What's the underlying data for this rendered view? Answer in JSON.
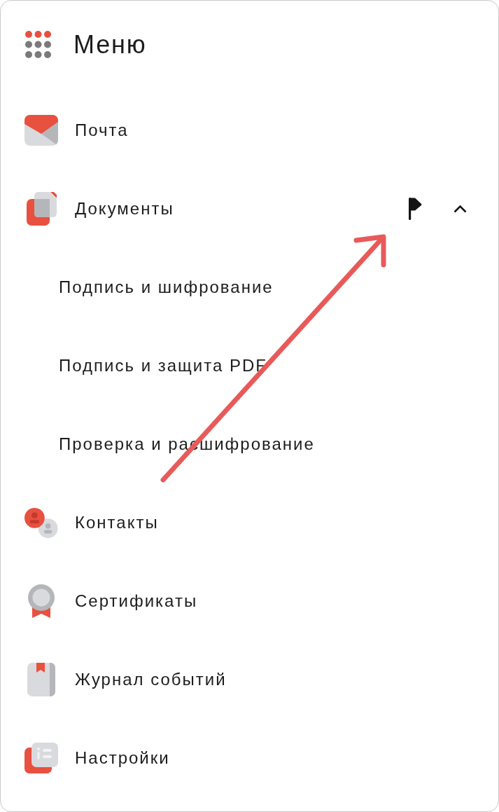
{
  "header": {
    "title": "Меню"
  },
  "items": [
    {
      "label": "Почта",
      "flagged": false
    },
    {
      "label": "Документы",
      "flagged": true,
      "expanded": true,
      "children": [
        {
          "label": "Подпись и шифрование"
        },
        {
          "label": "Подпись и защита PDF"
        },
        {
          "label": "Проверка и расшифрование"
        }
      ]
    },
    {
      "label": "Контакты",
      "flagged": false
    },
    {
      "label": "Сертификаты",
      "flagged": false
    },
    {
      "label": "Журнал событий",
      "flagged": false
    },
    {
      "label": "Настройки",
      "flagged": false
    }
  ]
}
